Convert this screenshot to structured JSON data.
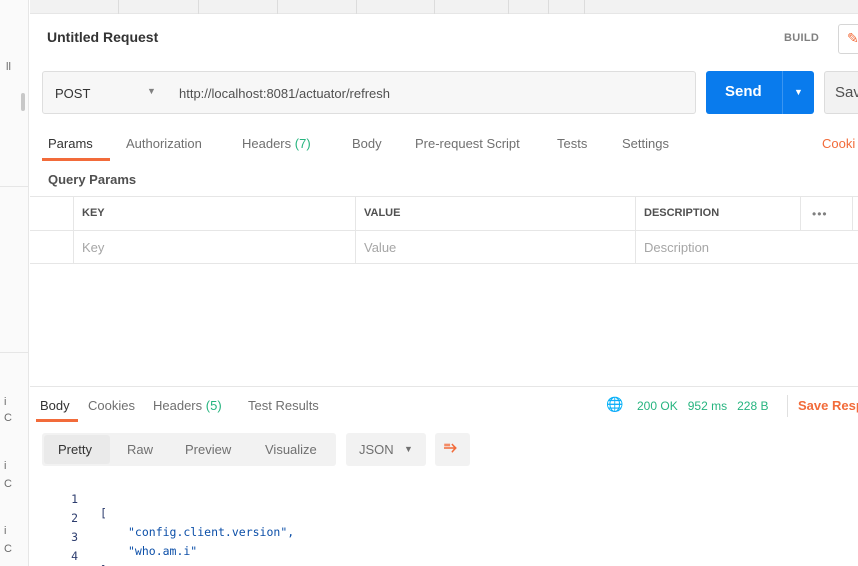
{
  "sidebar": {
    "fragments": [
      "ll",
      "i",
      "C",
      "i",
      "C",
      "i",
      "C"
    ]
  },
  "request": {
    "title": "Untitled Request",
    "build_label": "BUILD",
    "method": "POST",
    "url": "http://localhost:8081/actuator/refresh",
    "send_label": "Send",
    "save_label": "Sav"
  },
  "request_tabs": [
    {
      "label": "Params",
      "count": ""
    },
    {
      "label": "Authorization",
      "count": ""
    },
    {
      "label": "Headers",
      "count": "(7)"
    },
    {
      "label": "Body",
      "count": ""
    },
    {
      "label": "Pre-request Script",
      "count": ""
    },
    {
      "label": "Tests",
      "count": ""
    },
    {
      "label": "Settings",
      "count": ""
    }
  ],
  "cookies_label": "Cooki",
  "query_params": {
    "title": "Query Params",
    "columns": [
      "KEY",
      "VALUE",
      "DESCRIPTION"
    ],
    "more": "•••",
    "placeholders": [
      "Key",
      "Value",
      "Description"
    ]
  },
  "response_tabs": [
    {
      "label": "Body",
      "count": ""
    },
    {
      "label": "Cookies",
      "count": ""
    },
    {
      "label": "Headers",
      "count": "(5)"
    },
    {
      "label": "Test Results",
      "count": ""
    }
  ],
  "response_status": {
    "status": "200 OK",
    "time": "952 ms",
    "size": "228 B",
    "save_label": "Save Resp"
  },
  "view_modes": [
    "Pretty",
    "Raw",
    "Preview",
    "Visualize"
  ],
  "format": "JSON",
  "code_lines": [
    {
      "num": "1",
      "text": "["
    },
    {
      "num": "2",
      "text": "\"config.client.version\","
    },
    {
      "num": "3",
      "text": "\"who.am.i\""
    },
    {
      "num": "4",
      "text": "]"
    }
  ],
  "colors": {
    "accent": "#f26b3a",
    "send": "#097bed",
    "success": "#26b47f"
  }
}
